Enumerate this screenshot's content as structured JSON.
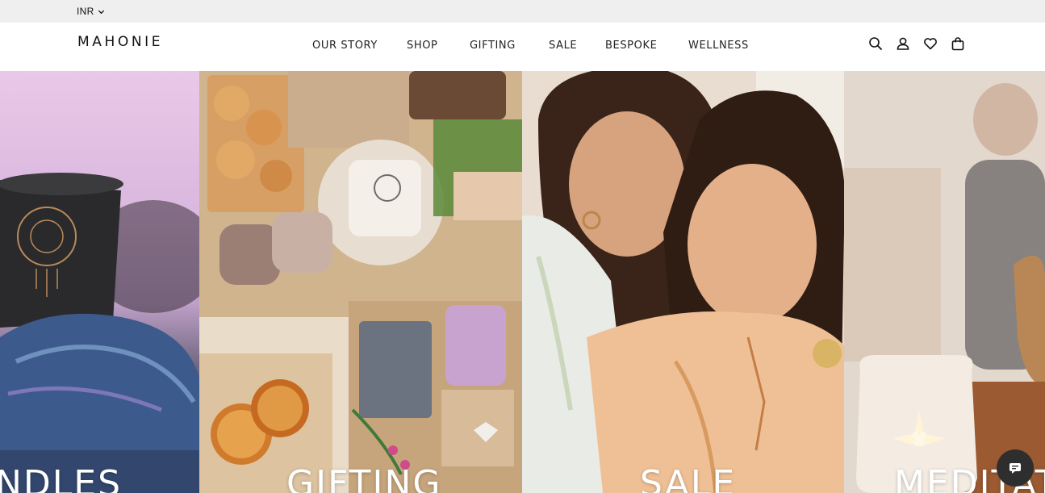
{
  "topbar": {
    "currency": "INR"
  },
  "header": {
    "logo": "MAHONIE",
    "nav": [
      {
        "label": "OUR STORY"
      },
      {
        "label": "SHOP"
      },
      {
        "label": "GIFTING"
      },
      {
        "label": "SALE"
      },
      {
        "label": "BESPOKE"
      },
      {
        "label": "WELLNESS"
      }
    ],
    "icons": [
      "search-icon",
      "account-icon",
      "wishlist-heart-icon",
      "cart-bag-icon"
    ]
  },
  "tiles": [
    {
      "label": "NDLES",
      "image": "candle-mug-on-crystal"
    },
    {
      "label": "GIFTING",
      "image": "gift-box-with-mug-candles-cookies"
    },
    {
      "label": "SALE",
      "image": "two-smiling-women"
    },
    {
      "label": "MEDITAT",
      "image": "meditation-diffuser"
    }
  ],
  "chat": {
    "icon": "chat-icon"
  },
  "colors": {
    "topbar_bg": "#efefef",
    "header_bg": "#ffffff",
    "text": "#111111",
    "chat_bg": "#2e2e2e"
  }
}
